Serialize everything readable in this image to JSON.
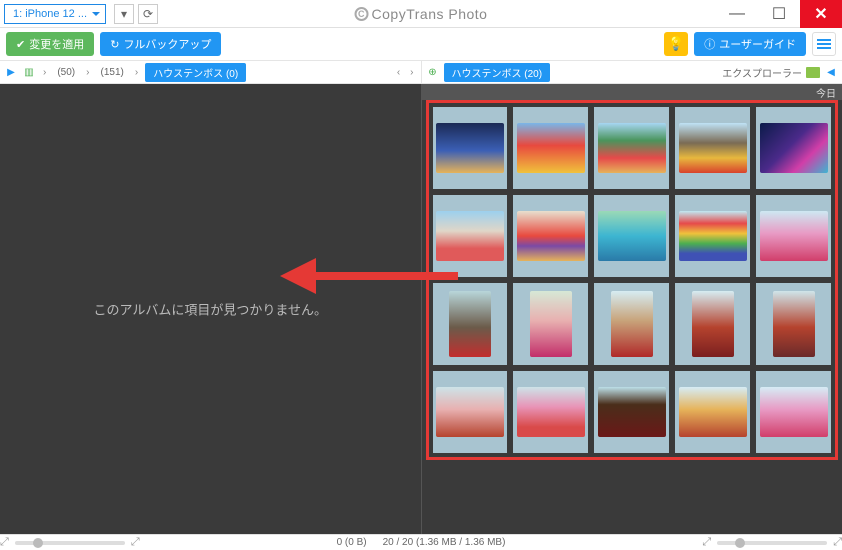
{
  "app": {
    "title": "CopyTrans Photo"
  },
  "titlebar": {
    "device": "1: iPhone 12 ..."
  },
  "toolbar": {
    "apply_label": "変更を適用",
    "backup_label": "フルバックアップ",
    "guide_label": "ユーザーガイド"
  },
  "crumb": {
    "left": {
      "count1": "(50)",
      "count2": "(151)",
      "album": "ハウステンボス (0)"
    },
    "right": {
      "album": "ハウステンボス (20)",
      "explorer": "エクスプローラー"
    }
  },
  "panes": {
    "left_empty": "このアルバムに項目が見つかりません。",
    "right_date": "今日"
  },
  "thumbs": [
    {
      "o": "l",
      "bg": "linear-gradient(#1b2a55,#3b5fb5 55%,#e6b35a)"
    },
    {
      "o": "l",
      "bg": "linear-gradient(#7ab6e8,#e8493e 45%,#f0c23c)"
    },
    {
      "o": "l",
      "bg": "linear-gradient(#a7d6f2,#4a945c 35%,#e64a4a 70%,#e6b35a)"
    },
    {
      "o": "l",
      "bg": "linear-gradient(#bfe2f5,#7a6b55 40%,#e8b83e 70%,#d9422c)"
    },
    {
      "o": "l",
      "bg": "linear-gradient(135deg,#0b1b4a,#4b2a8a 45%,#d13ea8 70%,#3db5d1)"
    },
    {
      "o": "l",
      "bg": "linear-gradient(#9cd0ee,#e0d6c8 40%,#e05a5a 75%)"
    },
    {
      "o": "l",
      "bg": "linear-gradient(#e8dfce,#e8493e 50%,#7a4aa6 70%,#e6b35a)"
    },
    {
      "o": "l",
      "bg": "linear-gradient(#9ad9b6,#3db5d1 50%,#2a7aa8)"
    },
    {
      "o": "l",
      "bg": "linear-gradient(#c0e8f2,#e64a4a 25%,#f0c23c 45%,#4caf50 65%,#3f51b5 85%)"
    },
    {
      "o": "l",
      "bg": "linear-gradient(#cde8f2,#e89ac4 45%,#d13e6a)"
    },
    {
      "o": "p",
      "bg": "linear-gradient(#b8d6da,#6b5b4a 55%,#c22e2e)"
    },
    {
      "o": "p",
      "bg": "linear-gradient(#d6e8d6,#e8b0b0 45%,#c22e6a)"
    },
    {
      "o": "p",
      "bg": "linear-gradient(#d6ecf2,#c8a37a 45%,#b02929)"
    },
    {
      "o": "p",
      "bg": "linear-gradient(#d6ecf2,#b5432e 55%,#7a1f1f)"
    },
    {
      "o": "p",
      "bg": "linear-gradient(#cfe5ea,#b5432e 55%,#6a2a2a)"
    },
    {
      "o": "l",
      "bg": "linear-gradient(#cde3e8,#e8b0b0 45%,#b5432e)"
    },
    {
      "o": "l",
      "bg": "linear-gradient(#cde3e8,#e893b6 40%,#d94a4a 80%)"
    },
    {
      "o": "l",
      "bg": "linear-gradient(#bcdfe8,#4a2e1a 35%,#6a1818)"
    },
    {
      "o": "l",
      "bg": "linear-gradient(#d6ecf5,#e6b35a 45%,#b5432e)"
    },
    {
      "o": "l",
      "bg": "linear-gradient(#d6ecf5,#e89ac4 45%,#d13e6a)"
    }
  ],
  "status": {
    "left": "0 (0 B)",
    "right": "20 / 20 (1.36 MB / 1.36 MB)"
  }
}
